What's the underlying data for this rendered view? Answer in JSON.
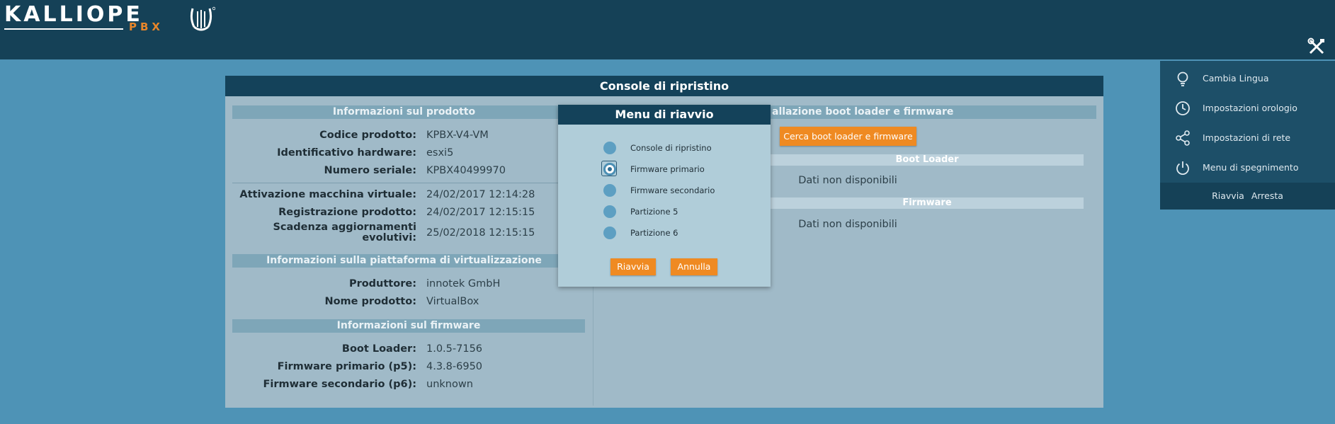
{
  "brand": {
    "logo_word": "KALLIOPE",
    "logo_sub": "PBX",
    "accent_color": "#ef8a22",
    "header_color": "#154157"
  },
  "console": {
    "title": "Console di ripristino",
    "product": {
      "section_title": "Informazioni sul prodotto",
      "rows": [
        {
          "label": "Codice prodotto:",
          "value": "KPBX-V4-VM"
        },
        {
          "label": "Identificativo hardware:",
          "value": "esxi5"
        },
        {
          "label": "Numero seriale:",
          "value": "KPBX40499970"
        }
      ],
      "rows2": [
        {
          "label": "Attivazione macchina virtuale:",
          "value": "24/02/2017 12:14:28"
        },
        {
          "label": "Registrazione prodotto:",
          "value": "24/02/2017 12:15:15"
        },
        {
          "label": "Scadenza aggiornamenti evolutivi:",
          "value": "25/02/2018 12:15:15"
        }
      ]
    },
    "virtualization": {
      "section_title": "Informazioni sulla piattaforma di virtualizzazione",
      "rows": [
        {
          "label": "Produttore:",
          "value": "innotek GmbH"
        },
        {
          "label": "Nome prodotto:",
          "value": "VirtualBox"
        }
      ]
    },
    "firmware_info": {
      "section_title": "Informazioni sul firmware",
      "rows": [
        {
          "label": "Boot Loader:",
          "value": "1.0.5-7156"
        },
        {
          "label": "Firmware primario (p5):",
          "value": "4.3.8-6950"
        },
        {
          "label": "Firmware secondario (p6):",
          "value": "unknown"
        }
      ]
    },
    "install": {
      "section_title_visible": "allazione boot loader e firmware",
      "find_button": "Cerca boot loader e firmware",
      "bootloader_title": "Boot Loader",
      "bootloader_status": "Dati non disponibili",
      "firmware_title": "Firmware",
      "firmware_status": "Dati non disponibili"
    }
  },
  "modal": {
    "title": "Menu di riavvio",
    "options": [
      {
        "label": "Console di ripristino",
        "checked": false
      },
      {
        "label": "Firmware primario",
        "checked": true
      },
      {
        "label": "Firmware secondario",
        "checked": false
      },
      {
        "label": "Partizione 5",
        "checked": false
      },
      {
        "label": "Partizione 6",
        "checked": false
      }
    ],
    "confirm": "Riavvia",
    "cancel": "Annulla"
  },
  "menu": {
    "items": [
      {
        "label": "Cambia Lingua",
        "icon": "bulb-icon"
      },
      {
        "label": "Impostazioni orologio",
        "icon": "clock-icon"
      },
      {
        "label": "Impostazioni di rete",
        "icon": "share-icon"
      },
      {
        "label": "Menu di spegnimento",
        "icon": "power-icon"
      }
    ],
    "footer_restart": "Riavvia",
    "footer_stop": "Arresta"
  }
}
